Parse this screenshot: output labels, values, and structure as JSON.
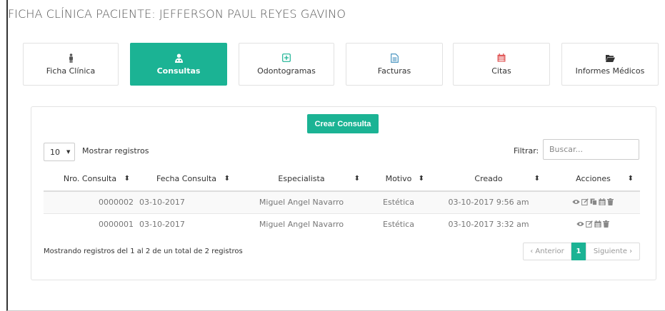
{
  "page": {
    "title": "FICHA CLÍNICA PACIENTE: JEFFERSON PAUL REYES GAVINO"
  },
  "tabs": [
    {
      "label": "Ficha Clínica",
      "icon": "person-icon",
      "color": "#555555"
    },
    {
      "label": "Consultas",
      "icon": "user-md-icon",
      "color": "#ffffff",
      "active": true
    },
    {
      "label": "Odontogramas",
      "icon": "plus-square-icon",
      "color": "#1bb394"
    },
    {
      "label": "Facturas",
      "icon": "file-icon",
      "color": "#3c8dbc"
    },
    {
      "label": "Citas",
      "icon": "calendar-icon",
      "color": "#e05a5a"
    },
    {
      "label": "Informes Médicos",
      "icon": "folder-open-icon",
      "color": "#333333"
    }
  ],
  "panel": {
    "create_button": "Crear Consulta",
    "length": {
      "value": "10",
      "label": "Mostrar registros"
    },
    "filter": {
      "label": "Filtrar:",
      "placeholder": "Buscar..."
    },
    "columns": [
      "Nro. Consulta",
      "Fecha Consulta",
      "Especialista",
      "Motivo",
      "Creado",
      "Acciones"
    ],
    "rows": [
      {
        "nro": "0000002",
        "fecha": "03-10-2017",
        "especialista": "Miguel Angel Navarro",
        "motivo": "Estética",
        "creado": "03-10-2017 9:56 am",
        "actions": [
          "eye-icon",
          "edit-icon",
          "copy-icon",
          "calendar-icon",
          "trash-icon"
        ]
      },
      {
        "nro": "0000001",
        "fecha": "03-10-2017",
        "especialista": "Miguel Angel Navarro",
        "motivo": "Estética",
        "creado": "03-10-2017 3:32 am",
        "actions": [
          "eye-icon",
          "edit-icon",
          "calendar-icon",
          "trash-icon"
        ]
      }
    ],
    "info": "Mostrando registros del 1 al 2 de un total de 2 registros",
    "pager": {
      "prev": "‹ Anterior",
      "current": "1",
      "next": "Siguiente ›"
    }
  },
  "colors": {
    "accent": "#1bb394",
    "border": "#e3e3e3"
  }
}
